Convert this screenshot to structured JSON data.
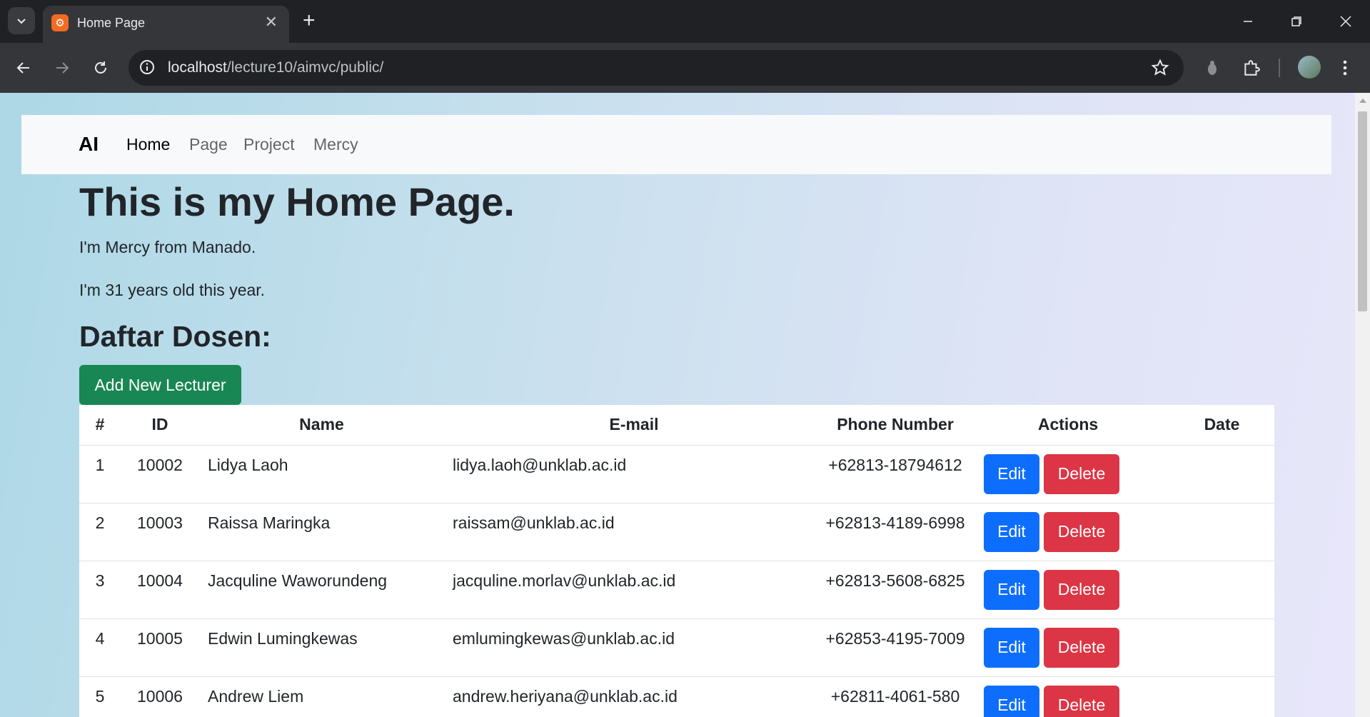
{
  "browser": {
    "tab_title": "Home Page",
    "url_host": "localhost",
    "url_path": "/lecture10/aimvc/public/"
  },
  "navbar": {
    "brand": "AI",
    "links": [
      "Home",
      "Page",
      "Project",
      "Mercy"
    ],
    "active": "Home"
  },
  "main": {
    "heading": "This is my Home Page.",
    "intro": "I'm Mercy from Manado.",
    "age": "I'm 31 years old this year.",
    "list_title": "Daftar Dosen:",
    "add_button": "Add New Lecturer"
  },
  "table": {
    "headers": [
      "#",
      "ID",
      "Name",
      "E-mail",
      "Phone Number",
      "Actions",
      "Date"
    ],
    "edit_label": "Edit",
    "delete_label": "Delete",
    "rows": [
      {
        "no": "1",
        "id": "10002",
        "name": "Lidya Laoh",
        "email": "lidya.laoh@unklab.ac.id",
        "phone": "+62813-18794612",
        "date": ""
      },
      {
        "no": "2",
        "id": "10003",
        "name": "Raissa Maringka",
        "email": "raissam@unklab.ac.id",
        "phone": "+62813-4189-6998",
        "date": ""
      },
      {
        "no": "3",
        "id": "10004",
        "name": "Jacquline Waworundeng",
        "email": "jacquline.morlav@unklab.ac.id",
        "phone": "+62813-5608-6825",
        "date": ""
      },
      {
        "no": "4",
        "id": "10005",
        "name": "Edwin Lumingkewas",
        "email": "emlumingkewas@unklab.ac.id",
        "phone": "+62853-4195-7009",
        "date": ""
      },
      {
        "no": "5",
        "id": "10006",
        "name": "Andrew Liem",
        "email": "andrew.heriyana@unklab.ac.id",
        "phone": "+62811-4061-580",
        "date": ""
      }
    ]
  },
  "colors": {
    "success": "#198754",
    "primary": "#0d6efd",
    "danger": "#dc3545",
    "navbar_bg": "#f8f9fa"
  }
}
